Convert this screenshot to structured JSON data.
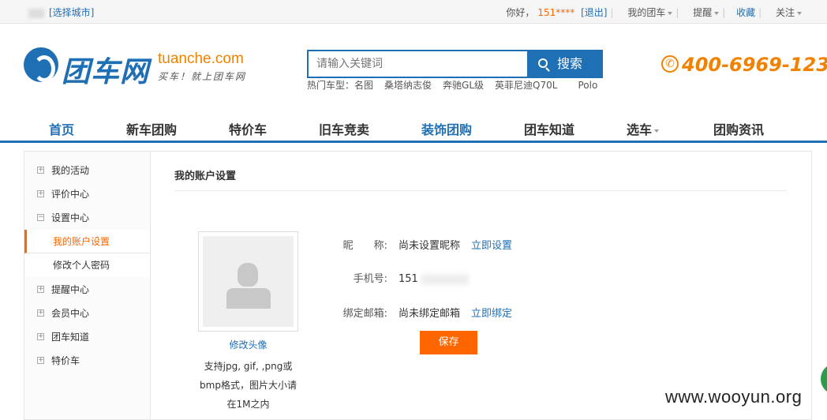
{
  "topbar": {
    "city_select": "[选择城市]",
    "greeting": "你好，",
    "username": "151****",
    "logout": "[退出]",
    "my_tuanche": "我的团车",
    "remind": "提醒",
    "favorites": "收藏",
    "follow": "关注"
  },
  "logo": {
    "cn": "团车网",
    "en": "tuanche.com",
    "slogan": "买车！就上团车网"
  },
  "search": {
    "placeholder": "请输入关键词",
    "button": "搜索"
  },
  "hot": {
    "label": "热门车型：",
    "items": [
      "名图",
      "桑塔纳志俊",
      "奔驰GL级",
      "英菲尼迪Q70L",
      "Polo"
    ]
  },
  "phone": "400-6969-123",
  "nav": [
    "首页",
    "新车团购",
    "特价车",
    "旧车竞卖",
    "装饰团购",
    "团车知道",
    "选车",
    "团购资讯"
  ],
  "sidebar": {
    "items": [
      "我的活动",
      "评价中心",
      "设置中心",
      "提醒中心",
      "会员中心",
      "团车知道",
      "特价车"
    ],
    "sub_items": [
      "我的账户设置",
      "修改个人密码"
    ]
  },
  "main": {
    "title": "我的账户设置",
    "avatar_link": "修改头像",
    "avatar_tip": [
      "支持jpg, gif, ,png或",
      "bmp格式，图片大小请",
      "在1M之内"
    ],
    "nickname_label": "昵　　称:",
    "nickname_value": "尚未设置昵称",
    "nickname_action": "立即设置",
    "phone_label": "手机号:",
    "phone_value": "151",
    "email_label": "绑定邮箱:",
    "email_value": "尚未绑定邮箱",
    "email_action": "立即绑定",
    "save_button": "保存"
  },
  "watermark": "www.wooyun.org",
  "colors": {
    "brand_blue": "#1f6fb5",
    "accent_orange": "#f60"
  }
}
